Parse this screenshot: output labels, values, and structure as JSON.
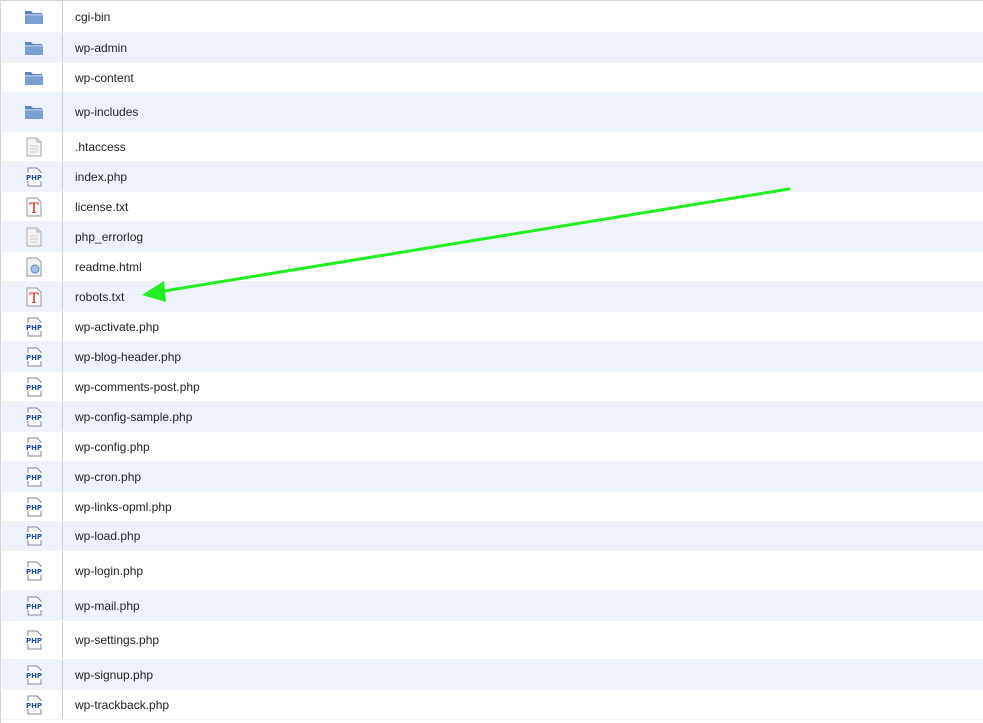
{
  "files": [
    {
      "name": "cgi-bin",
      "type": "folder",
      "icon": "folder-icon"
    },
    {
      "name": "wp-admin",
      "type": "folder",
      "icon": "folder-icon"
    },
    {
      "name": "wp-content",
      "type": "folder",
      "icon": "folder-icon"
    },
    {
      "name": "wp-includes",
      "type": "folder",
      "icon": "folder-icon"
    },
    {
      "name": ".htaccess",
      "type": "generic",
      "icon": "generic-file-icon"
    },
    {
      "name": "index.php",
      "type": "php",
      "icon": "php-file-icon"
    },
    {
      "name": "license.txt",
      "type": "text",
      "icon": "text-file-icon"
    },
    {
      "name": "php_errorlog",
      "type": "generic",
      "icon": "generic-file-icon"
    },
    {
      "name": "readme.html",
      "type": "html",
      "icon": "html-file-icon"
    },
    {
      "name": "robots.txt",
      "type": "text",
      "icon": "text-file-icon"
    },
    {
      "name": "wp-activate.php",
      "type": "php",
      "icon": "php-file-icon"
    },
    {
      "name": "wp-blog-header.php",
      "type": "php",
      "icon": "php-file-icon"
    },
    {
      "name": "wp-comments-post.php",
      "type": "php",
      "icon": "php-file-icon"
    },
    {
      "name": "wp-config-sample.php",
      "type": "php",
      "icon": "php-file-icon"
    },
    {
      "name": "wp-config.php",
      "type": "php",
      "icon": "php-file-icon"
    },
    {
      "name": "wp-cron.php",
      "type": "php",
      "icon": "php-file-icon"
    },
    {
      "name": "wp-links-opml.php",
      "type": "php",
      "icon": "php-file-icon"
    },
    {
      "name": "wp-load.php",
      "type": "php",
      "icon": "php-file-icon"
    },
    {
      "name": "wp-login.php",
      "type": "php",
      "icon": "php-file-icon"
    },
    {
      "name": "wp-mail.php",
      "type": "php",
      "icon": "php-file-icon"
    },
    {
      "name": "wp-settings.php",
      "type": "php",
      "icon": "php-file-icon"
    },
    {
      "name": "wp-signup.php",
      "type": "php",
      "icon": "php-file-icon"
    },
    {
      "name": "wp-trackback.php",
      "type": "php",
      "icon": "php-file-icon"
    }
  ],
  "annotation": {
    "icon": "green-arrow-icon",
    "color": "#22ee22",
    "points_to": "robots.txt"
  },
  "colors": {
    "row_alt": "#eef3fb",
    "folder": "#6f93c4",
    "text_icon_red": "#d0281f",
    "php_blue": "#1f4e9a",
    "arrow": "#22ee22"
  }
}
